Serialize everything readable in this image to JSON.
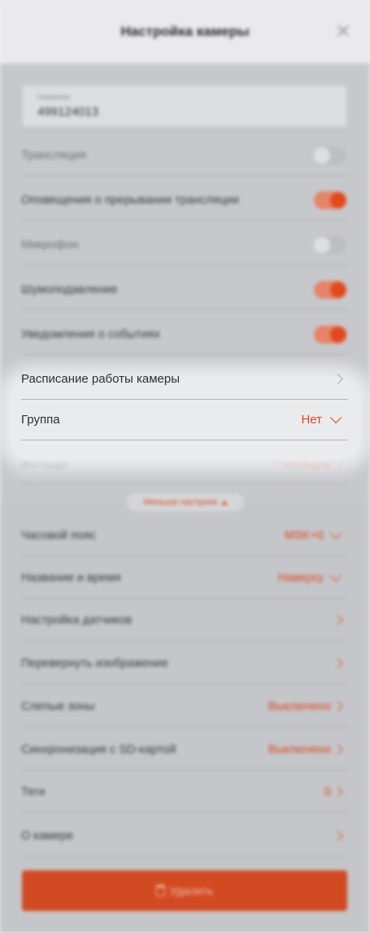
{
  "header": {
    "title": "Настройка камеры"
  },
  "name_field": {
    "label": "Название",
    "value": "499124013"
  },
  "settings": [
    {
      "key": "broadcast",
      "label": "Трансляция",
      "toggle": "off"
    },
    {
      "key": "interrupt_alerts",
      "label": "Оповещения о прерывании трансляции",
      "toggle": "on"
    },
    {
      "key": "microphone",
      "label": "Микрофон",
      "toggle": "off"
    },
    {
      "key": "noise_reduction",
      "label": "Шумоподавление",
      "toggle": "on"
    },
    {
      "key": "event_notifications",
      "label": "Уведомления о событиях",
      "toggle": "on"
    }
  ],
  "schedule": {
    "label": "Расписание работы камеры"
  },
  "group": {
    "label": "Группа",
    "value": "Нет"
  },
  "residents": {
    "label": "Жильцы",
    "value": "7 жильцов"
  },
  "less_settings_label": "Меньше настроек",
  "advanced": [
    {
      "label": "Часовой пояс",
      "value": "MSK+0",
      "control": "dropdown"
    },
    {
      "label": "Название и время",
      "value": "Наверху",
      "control": "dropdown"
    },
    {
      "label": "Настройка датчиков",
      "value": "",
      "control": "link"
    },
    {
      "label": "Перевернуть изображение",
      "value": "",
      "control": "link"
    },
    {
      "label": "Слепые зоны",
      "value": "Выключено",
      "control": "link"
    },
    {
      "label": "Синхронизация с SD-картой",
      "value": "Выключено",
      "control": "link"
    },
    {
      "label": "Теги",
      "value": "0",
      "control": "link"
    },
    {
      "label": "О камере",
      "value": "",
      "control": "link"
    }
  ],
  "delete_button": {
    "label": "Удалить"
  },
  "colors": {
    "accent": "#d9461f",
    "toggle_on": "#e24a1c",
    "overlay": "#c7c8cc"
  }
}
